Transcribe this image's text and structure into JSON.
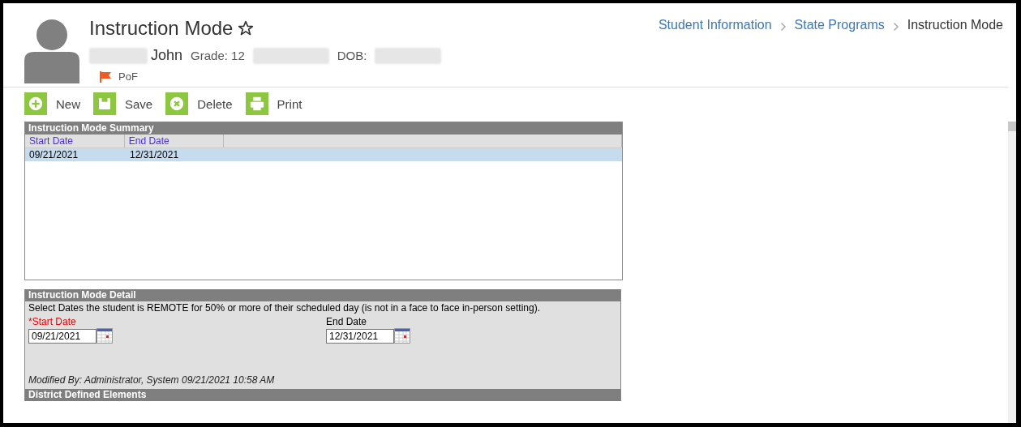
{
  "header": {
    "title": "Instruction Mode",
    "favorite": false,
    "student_name": "John",
    "grade": "Grade: 12",
    "dob_label": "DOB:",
    "flag": "PoF"
  },
  "breadcrumb": [
    {
      "label": "Student Information",
      "current": false
    },
    {
      "label": "State Programs",
      "current": false
    },
    {
      "label": "Instruction Mode",
      "current": true
    }
  ],
  "toolbar": [
    {
      "label": "New",
      "kind": "new"
    },
    {
      "label": "Save",
      "kind": "save"
    },
    {
      "label": "Delete",
      "kind": "delete"
    },
    {
      "label": "Print",
      "kind": "print"
    }
  ],
  "summary": {
    "title": "Instruction Mode Summary",
    "columns": [
      "Start Date",
      "End Date"
    ],
    "rows": [
      {
        "cells": [
          "09/21/2021",
          "12/31/2021"
        ],
        "selected": true
      }
    ]
  },
  "detail": {
    "title": "Instruction Mode Detail",
    "instructions": "Select Dates the student is REMOTE for 50% or more of their scheduled day (is not in a face to face in-person setting).",
    "fields": [
      {
        "label": "*Start Date",
        "required": true,
        "value": "09/21/2021"
      },
      {
        "label": "End Date",
        "required": false,
        "value": "12/31/2021"
      }
    ],
    "modified": "Modified By: Administrator, System 09/21/2021 10:58 AM",
    "section": "District Defined Elements"
  }
}
